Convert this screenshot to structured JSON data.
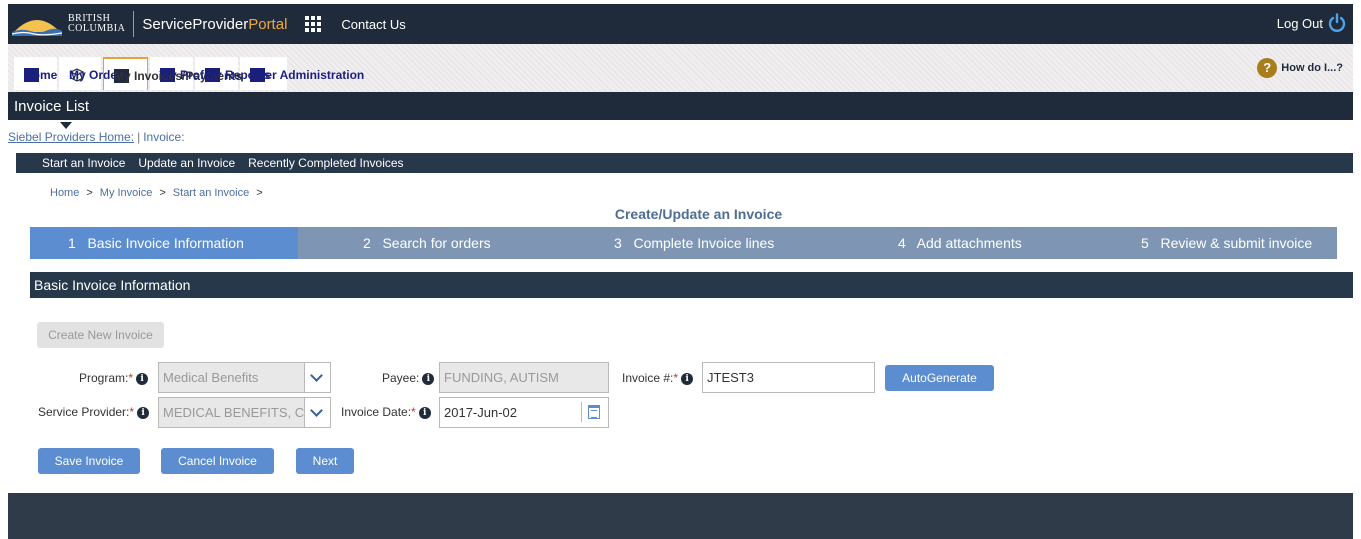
{
  "header": {
    "brand_line1": "BRITISH",
    "brand_line2": "COLUMBIA",
    "portal_name": "ServiceProvider",
    "portal_accent": "Portal",
    "contact": "Contact Us",
    "logout": "Log Out"
  },
  "tabs": [
    {
      "label": "Home",
      "icon": "square-icon"
    },
    {
      "label": "My Orders",
      "icon": "orders-icon"
    },
    {
      "label": "My Invoices/Payments",
      "icon": "square-icon",
      "active": true
    },
    {
      "label": "My Profile",
      "icon": "square-icon"
    },
    {
      "label": "My Reports",
      "icon": "square-icon"
    },
    {
      "label": "User Administration",
      "icon": "square-icon"
    }
  ],
  "help": {
    "label": "How do I...?"
  },
  "list_title": "Invoice List",
  "crumbs_top": {
    "home": "Siebel Providers Home:",
    "sep": "|",
    "current": "Invoice:"
  },
  "subnav": [
    "Start an Invoice",
    "Update an Invoice",
    "Recently Completed Invoices"
  ],
  "breadcrumb": [
    "Home",
    "My Invoice",
    "Start an Invoice"
  ],
  "form_title": "Create/Update an Invoice",
  "steps": [
    "1   Basic Invoice Information",
    "2   Search for orders",
    "3   Complete Invoice lines",
    "4   Add attachments",
    "5   Review & submit invoice"
  ],
  "section_title": "Basic Invoice Information",
  "form": {
    "create_new": "Create New Invoice",
    "program_label": "Program:",
    "program_value": "Medical Benefits",
    "payee_label": "Payee:",
    "payee_value": "FUNDING, AUTISM",
    "invoice_no_label": "Invoice #:",
    "invoice_no_value": "JTEST3",
    "autogenerate": "AutoGenerate",
    "provider_label": "Service Provider:",
    "provider_value": "MEDICAL BENEFITS, C",
    "date_label": "Invoice Date:",
    "date_value": "2017-Jun-02",
    "required_mark": "*",
    "info_glyph": "i"
  },
  "actions": {
    "save": "Save Invoice",
    "cancel": "Cancel Invoice",
    "next": "Next"
  },
  "colors": {
    "header_bg": "#1f2b3a",
    "accent": "#f2a93b",
    "step_active": "#5c8dd0",
    "step_bg": "#7e96b4",
    "button": "#5c8dd0"
  }
}
